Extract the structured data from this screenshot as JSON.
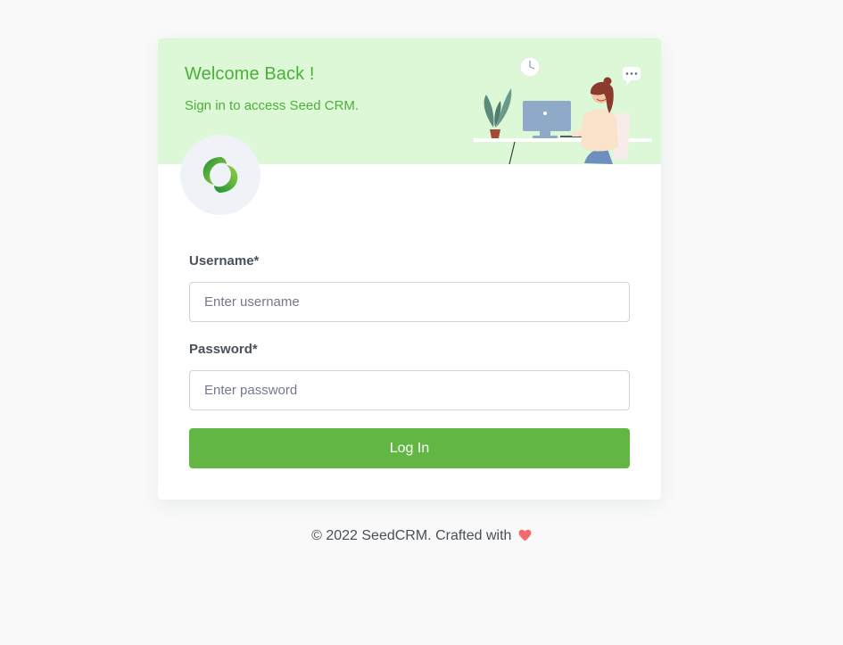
{
  "header": {
    "title": "Welcome Back !",
    "subtitle": "Sign in to access Seed CRM."
  },
  "form": {
    "username_label": "Username*",
    "username_placeholder": "Enter username",
    "username_value": "",
    "password_label": "Password*",
    "password_placeholder": "Enter password",
    "password_value": "",
    "submit_label": "Log In"
  },
  "footer": {
    "text": "© 2022 SeedCRM. Crafted with"
  },
  "colors": {
    "brand_green": "#62b744",
    "header_bg": "#ddf8d7",
    "heart": "#f46a6a"
  },
  "icons": {
    "logo": "seedcrm-logo-icon",
    "heart": "heart-icon",
    "illustration": "workspace-illustration"
  }
}
